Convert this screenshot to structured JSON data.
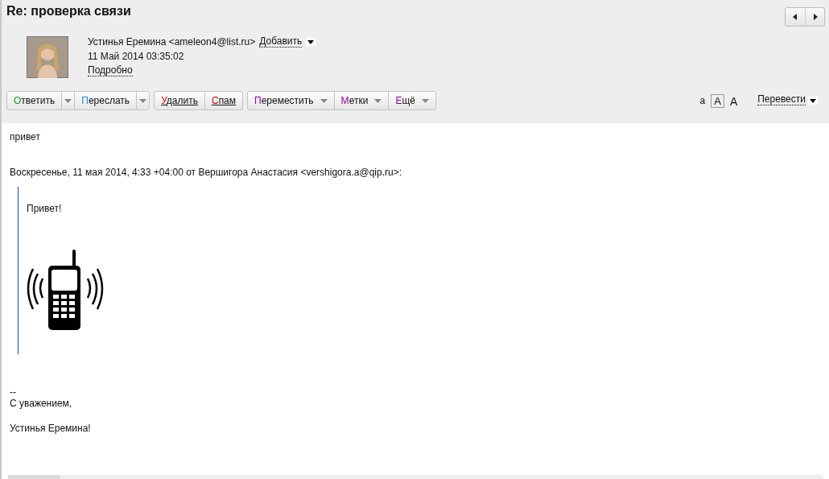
{
  "subject": "Re: проверка связи",
  "sender": {
    "from": "Устинья Еремина <ameleon4@list.ru>",
    "add_link": "Добавить",
    "date": "11 Май 2014 03:35:02",
    "details_link": "Подробно"
  },
  "toolbar": [
    [
      {
        "label": "Ответить",
        "kind": "split",
        "color": "#1a9a1a"
      },
      {
        "label": "Переслать",
        "kind": "split",
        "color": "#1a8ad4"
      }
    ],
    [
      {
        "label": "Удалить",
        "kind": "link",
        "color": "#cc0000"
      },
      {
        "label": "Спам",
        "kind": "link",
        "color": "#cc0000"
      }
    ],
    [
      {
        "label": "Переместить",
        "kind": "menu",
        "color": "#8a00a0"
      },
      {
        "label": "Метки",
        "kind": "menu",
        "color": "#8a00a0"
      },
      {
        "label": "Ещё",
        "kind": "menu",
        "color": "#8a00a0"
      }
    ]
  ],
  "font_sizes": [
    {
      "label": "а",
      "selected": false
    },
    {
      "label": "А",
      "selected": true
    },
    {
      "label": "А",
      "selected": false
    }
  ],
  "translate": "Перевести",
  "body": {
    "greeting": "привет",
    "quote_header": "Воскресенье, 11 мая 2014, 4:33 +04:00 от Вершигора Анастасия <vershigora.a@qip.ru>:",
    "quote_text": "Привет!",
    "signature": [
      "--",
      "С уважением,",
      "Устинья Еремина!"
    ]
  }
}
